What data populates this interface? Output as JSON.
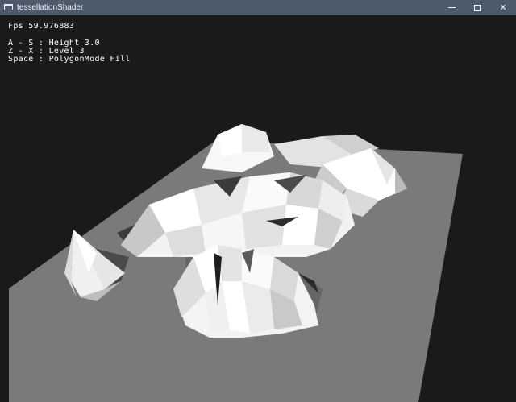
{
  "window": {
    "title": "tessellationShader",
    "controls": {
      "minimize": "minimize",
      "maximize": "maximize",
      "close": "✕"
    }
  },
  "hud": {
    "fps": "Fps 59.976883",
    "height": "A - S : Height 3.0",
    "level": "Z - X : Level 3",
    "polygon": "Space : PolygonMode Fill"
  },
  "colors": {
    "background": "#1a1a1a",
    "ground": "#7a7a7a",
    "terrain_light": "#f4f4f4",
    "terrain_shadow": "#2a2a2a",
    "titlebar": "#4c5a6b"
  }
}
